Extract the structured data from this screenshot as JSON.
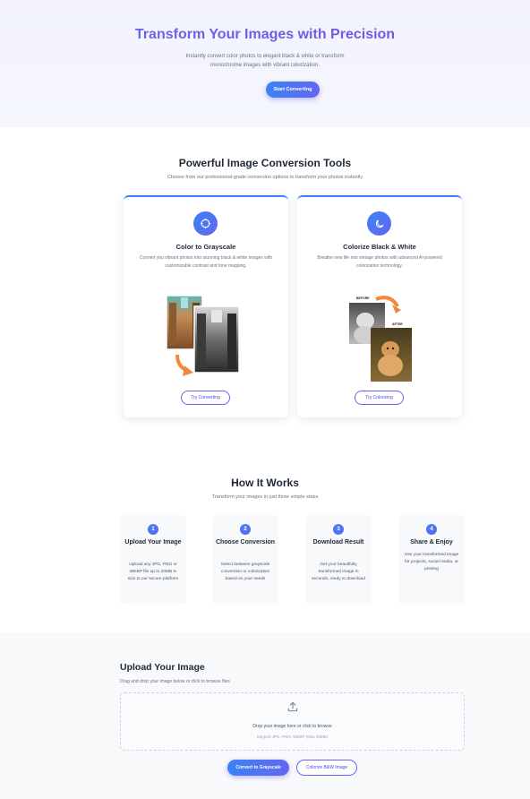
{
  "hero": {
    "title": "Transform Your Images with Precision",
    "subtitle": "Instantly convert color photos to elegant black & white or transform monochrome images with vibrant colorization.",
    "cta_label": "Start Converting"
  },
  "tools": {
    "title": "Powerful Image Conversion Tools",
    "subtitle": "Choose from our professional-grade conversion options to transform your photos instantly",
    "cards": [
      {
        "icon": "grayscale-icon",
        "title": "Color to Grayscale",
        "description": "Convert you vibrant photos into stunning black & white images with customizable contrast and tone mapping.",
        "button": "Try Converting"
      },
      {
        "icon": "moon-icon",
        "title": "Colorize Black & White",
        "description": "Breathe new life into vintage photos with advanced AI-powered colorization technology.",
        "button": "Try Colorizing",
        "image_labels": {
          "before": "BEFORE",
          "after": "AFTER"
        }
      }
    ]
  },
  "how": {
    "title": "How It Works",
    "subtitle": "Transform your images in just three simple steps",
    "steps": [
      {
        "num": "1",
        "title": "Upload Your Image",
        "text": "Upload any JPG, PNG or WEBP file up to 20MB in size to our secure platform"
      },
      {
        "num": "2",
        "title": "Choose Conversion",
        "text": "Select between grayscale conversion or colorization based on your needs"
      },
      {
        "num": "3",
        "title": "Download Result",
        "text": "Get your beautifully transformed image in seconds, ready to download"
      },
      {
        "num": "4",
        "title": "Share & Enjoy",
        "text": "Use your transformed image for projects, social media, or printing"
      }
    ]
  },
  "upload": {
    "title": "Upload Your Image",
    "subtitle": "Drag and drop your image below or click to browse files",
    "drop_text": "Drop your image here or click to browse",
    "formats": "Support JPG, PNG, WEBP (Max 20MB)",
    "btn_grayscale": "Convert to Grayscale",
    "btn_colorize": "Colorize B&W Image"
  },
  "colors": {
    "accent_blue": "#3b82f6",
    "accent_indigo": "#6366f1",
    "title_purple": "#6c4fe0",
    "arrow_orange": "#f08a3a"
  }
}
